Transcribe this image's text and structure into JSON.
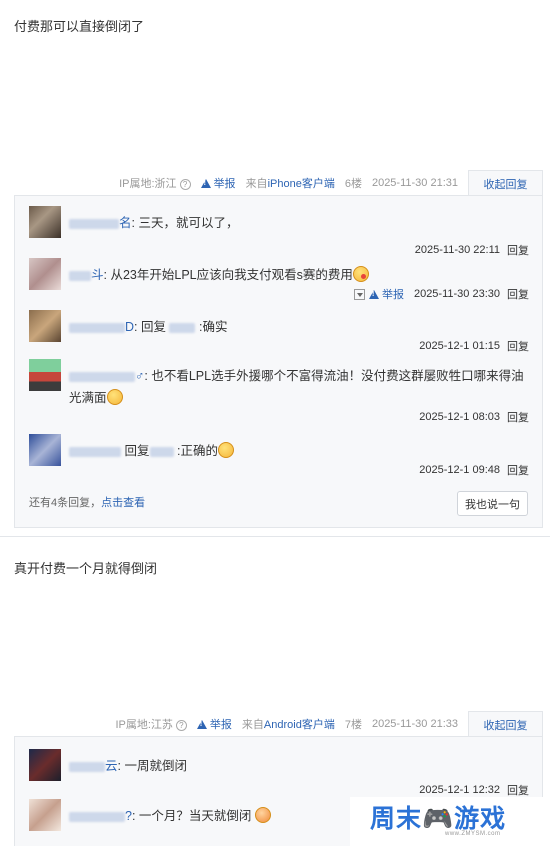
{
  "post1": {
    "body": "付费那可以直接倒闭了",
    "meta": {
      "ip_label": "IP属地:浙江",
      "report_label": "举报",
      "client_prefix": "来自",
      "client_name": "iPhone客户端",
      "floor": "6楼",
      "time": "2025-11-30 21:31",
      "collapse_label": "收起回复"
    },
    "replies": [
      {
        "name_tail": "名",
        "text": "三天，就可以了，",
        "time": "2025-11-30 22:11",
        "reply_label": "回复"
      },
      {
        "name_tail": "斗",
        "text": "从23年开始LPL应该向我支付观看s赛的费用",
        "time": "2025-11-30 23:30",
        "reply_label": "回复",
        "report_label": "举报"
      },
      {
        "name_tail": "D",
        "text": "回复",
        "text2": ":确实",
        "time": "2025-12-1 01:15",
        "reply_label": "回复"
      },
      {
        "name_tail": "♂",
        "text": "也不看LPL选手外援哪个不富得流油！没付费这群屡败牲口哪来得油光满面",
        "time": "2025-12-1 08:03",
        "reply_label": "回复"
      },
      {
        "name_tail": "",
        "text": "回复",
        "text2": ":正确的",
        "time": "2025-12-1 09:48",
        "reply_label": "回复"
      }
    ],
    "more_prefix": "还有4条回复，",
    "more_link": "点击查看",
    "say_button": "我也说一句"
  },
  "post2": {
    "body": "真开付费一个月就得倒闭",
    "meta": {
      "ip_label": "IP属地:江苏",
      "report_label": "举报",
      "client_prefix": "来自",
      "client_name": "Android客户端",
      "floor": "7楼",
      "time": "2025-11-30 21:33",
      "collapse_label": "收起回复"
    },
    "replies": [
      {
        "name_tail": "云",
        "text": "一周就倒闭",
        "time": "2025-12-1 12:32",
        "reply_label": "回复"
      },
      {
        "name_tail": "?",
        "text": "一个月？当天就倒闭"
      }
    ]
  },
  "watermark": {
    "main_a": "周末",
    "main_b": "游戏",
    "sub": "www.ZMYSM.com"
  },
  "colors": {
    "link": "#2d64b3",
    "reply_bg": "#f7f8fa",
    "watermark_blue": "#2b72d6"
  }
}
